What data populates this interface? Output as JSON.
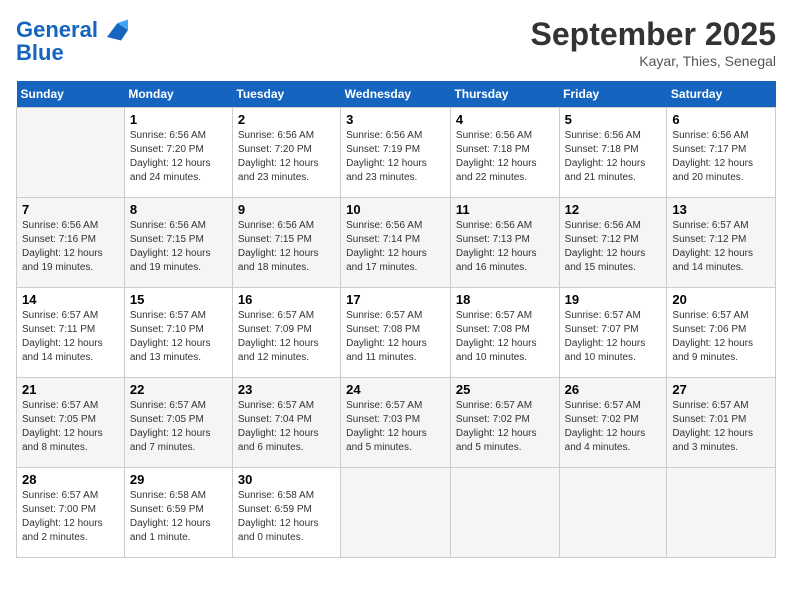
{
  "header": {
    "logo_line1": "General",
    "logo_line2": "Blue",
    "month": "September 2025",
    "location": "Kayar, Thies, Senegal"
  },
  "days_of_week": [
    "Sunday",
    "Monday",
    "Tuesday",
    "Wednesday",
    "Thursday",
    "Friday",
    "Saturday"
  ],
  "weeks": [
    [
      {
        "num": "",
        "info": ""
      },
      {
        "num": "1",
        "info": "Sunrise: 6:56 AM\nSunset: 7:20 PM\nDaylight: 12 hours\nand 24 minutes."
      },
      {
        "num": "2",
        "info": "Sunrise: 6:56 AM\nSunset: 7:20 PM\nDaylight: 12 hours\nand 23 minutes."
      },
      {
        "num": "3",
        "info": "Sunrise: 6:56 AM\nSunset: 7:19 PM\nDaylight: 12 hours\nand 23 minutes."
      },
      {
        "num": "4",
        "info": "Sunrise: 6:56 AM\nSunset: 7:18 PM\nDaylight: 12 hours\nand 22 minutes."
      },
      {
        "num": "5",
        "info": "Sunrise: 6:56 AM\nSunset: 7:18 PM\nDaylight: 12 hours\nand 21 minutes."
      },
      {
        "num": "6",
        "info": "Sunrise: 6:56 AM\nSunset: 7:17 PM\nDaylight: 12 hours\nand 20 minutes."
      }
    ],
    [
      {
        "num": "7",
        "info": "Sunrise: 6:56 AM\nSunset: 7:16 PM\nDaylight: 12 hours\nand 19 minutes."
      },
      {
        "num": "8",
        "info": "Sunrise: 6:56 AM\nSunset: 7:15 PM\nDaylight: 12 hours\nand 19 minutes."
      },
      {
        "num": "9",
        "info": "Sunrise: 6:56 AM\nSunset: 7:15 PM\nDaylight: 12 hours\nand 18 minutes."
      },
      {
        "num": "10",
        "info": "Sunrise: 6:56 AM\nSunset: 7:14 PM\nDaylight: 12 hours\nand 17 minutes."
      },
      {
        "num": "11",
        "info": "Sunrise: 6:56 AM\nSunset: 7:13 PM\nDaylight: 12 hours\nand 16 minutes."
      },
      {
        "num": "12",
        "info": "Sunrise: 6:56 AM\nSunset: 7:12 PM\nDaylight: 12 hours\nand 15 minutes."
      },
      {
        "num": "13",
        "info": "Sunrise: 6:57 AM\nSunset: 7:12 PM\nDaylight: 12 hours\nand 14 minutes."
      }
    ],
    [
      {
        "num": "14",
        "info": "Sunrise: 6:57 AM\nSunset: 7:11 PM\nDaylight: 12 hours\nand 14 minutes."
      },
      {
        "num": "15",
        "info": "Sunrise: 6:57 AM\nSunset: 7:10 PM\nDaylight: 12 hours\nand 13 minutes."
      },
      {
        "num": "16",
        "info": "Sunrise: 6:57 AM\nSunset: 7:09 PM\nDaylight: 12 hours\nand 12 minutes."
      },
      {
        "num": "17",
        "info": "Sunrise: 6:57 AM\nSunset: 7:08 PM\nDaylight: 12 hours\nand 11 minutes."
      },
      {
        "num": "18",
        "info": "Sunrise: 6:57 AM\nSunset: 7:08 PM\nDaylight: 12 hours\nand 10 minutes."
      },
      {
        "num": "19",
        "info": "Sunrise: 6:57 AM\nSunset: 7:07 PM\nDaylight: 12 hours\nand 10 minutes."
      },
      {
        "num": "20",
        "info": "Sunrise: 6:57 AM\nSunset: 7:06 PM\nDaylight: 12 hours\nand 9 minutes."
      }
    ],
    [
      {
        "num": "21",
        "info": "Sunrise: 6:57 AM\nSunset: 7:05 PM\nDaylight: 12 hours\nand 8 minutes."
      },
      {
        "num": "22",
        "info": "Sunrise: 6:57 AM\nSunset: 7:05 PM\nDaylight: 12 hours\nand 7 minutes."
      },
      {
        "num": "23",
        "info": "Sunrise: 6:57 AM\nSunset: 7:04 PM\nDaylight: 12 hours\nand 6 minutes."
      },
      {
        "num": "24",
        "info": "Sunrise: 6:57 AM\nSunset: 7:03 PM\nDaylight: 12 hours\nand 5 minutes."
      },
      {
        "num": "25",
        "info": "Sunrise: 6:57 AM\nSunset: 7:02 PM\nDaylight: 12 hours\nand 5 minutes."
      },
      {
        "num": "26",
        "info": "Sunrise: 6:57 AM\nSunset: 7:02 PM\nDaylight: 12 hours\nand 4 minutes."
      },
      {
        "num": "27",
        "info": "Sunrise: 6:57 AM\nSunset: 7:01 PM\nDaylight: 12 hours\nand 3 minutes."
      }
    ],
    [
      {
        "num": "28",
        "info": "Sunrise: 6:57 AM\nSunset: 7:00 PM\nDaylight: 12 hours\nand 2 minutes."
      },
      {
        "num": "29",
        "info": "Sunrise: 6:58 AM\nSunset: 6:59 PM\nDaylight: 12 hours\nand 1 minute."
      },
      {
        "num": "30",
        "info": "Sunrise: 6:58 AM\nSunset: 6:59 PM\nDaylight: 12 hours\nand 0 minutes."
      },
      {
        "num": "",
        "info": ""
      },
      {
        "num": "",
        "info": ""
      },
      {
        "num": "",
        "info": ""
      },
      {
        "num": "",
        "info": ""
      }
    ]
  ]
}
